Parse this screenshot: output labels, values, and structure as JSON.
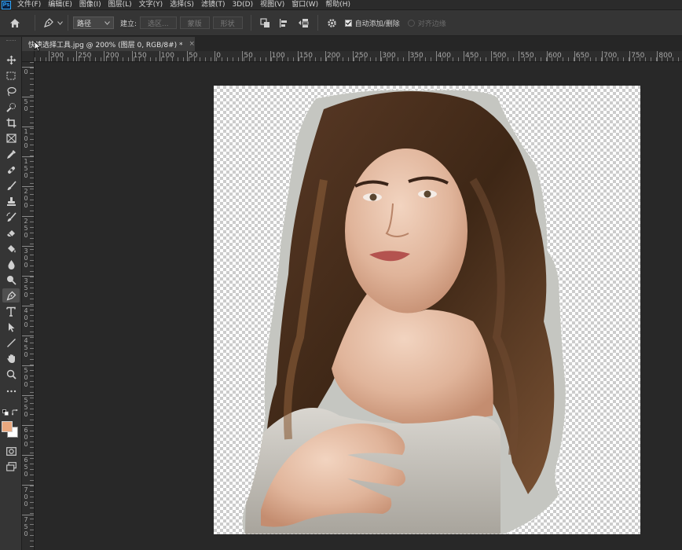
{
  "app": {
    "logo": "Ps"
  },
  "menu": [
    "文件(F)",
    "编辑(E)",
    "图像(I)",
    "图层(L)",
    "文字(Y)",
    "选择(S)",
    "滤镜(T)",
    "3D(D)",
    "视图(V)",
    "窗口(W)",
    "帮助(H)"
  ],
  "options": {
    "mode_select": "路径",
    "build_label": "建立:",
    "btn_selection": "选区...",
    "btn_mask": "蒙版",
    "btn_shape": "形状",
    "auto_add_delete": "自动添加/删除",
    "auto_add_delete_checked": true,
    "align_edges": "对齐边缘"
  },
  "document": {
    "tab_title": "快速选择工具.jpg @ 200% (图层 0, RGB/8#) *",
    "close_glyph": "×"
  },
  "ruler_h_labels": [
    "300",
    "250",
    "200",
    "150",
    "100",
    "50",
    "0",
    "50",
    "100",
    "150",
    "200",
    "250",
    "300",
    "350",
    "400",
    "450",
    "500",
    "550",
    "600",
    "650",
    "700",
    "750",
    "800"
  ],
  "ruler_v_labels": [
    "0",
    "50",
    "100",
    "150",
    "200",
    "250",
    "300",
    "350",
    "400",
    "450",
    "500",
    "550",
    "600",
    "650",
    "700",
    "750"
  ],
  "colors": {
    "foreground": "#e8a77e",
    "background": "#ffffff",
    "accent": "#31a8ff",
    "panel": "#353535",
    "workspace": "#282828"
  },
  "tools": [
    "move-tool-icon",
    "marquee-tool-icon",
    "lasso-tool-icon",
    "quick-selection-tool-icon",
    "crop-tool-icon",
    "frame-tool-icon",
    "eyedropper-tool-icon",
    "healing-brush-tool-icon",
    "brush-tool-icon",
    "clone-stamp-tool-icon",
    "history-brush-tool-icon",
    "eraser-tool-icon",
    "paint-bucket-tool-icon",
    "blur-tool-icon",
    "dodge-tool-icon",
    "pen-tool-icon",
    "type-tool-icon",
    "path-selection-tool-icon",
    "line-tool-icon",
    "hand-tool-icon",
    "zoom-tool-icon",
    "more-tools-icon"
  ]
}
